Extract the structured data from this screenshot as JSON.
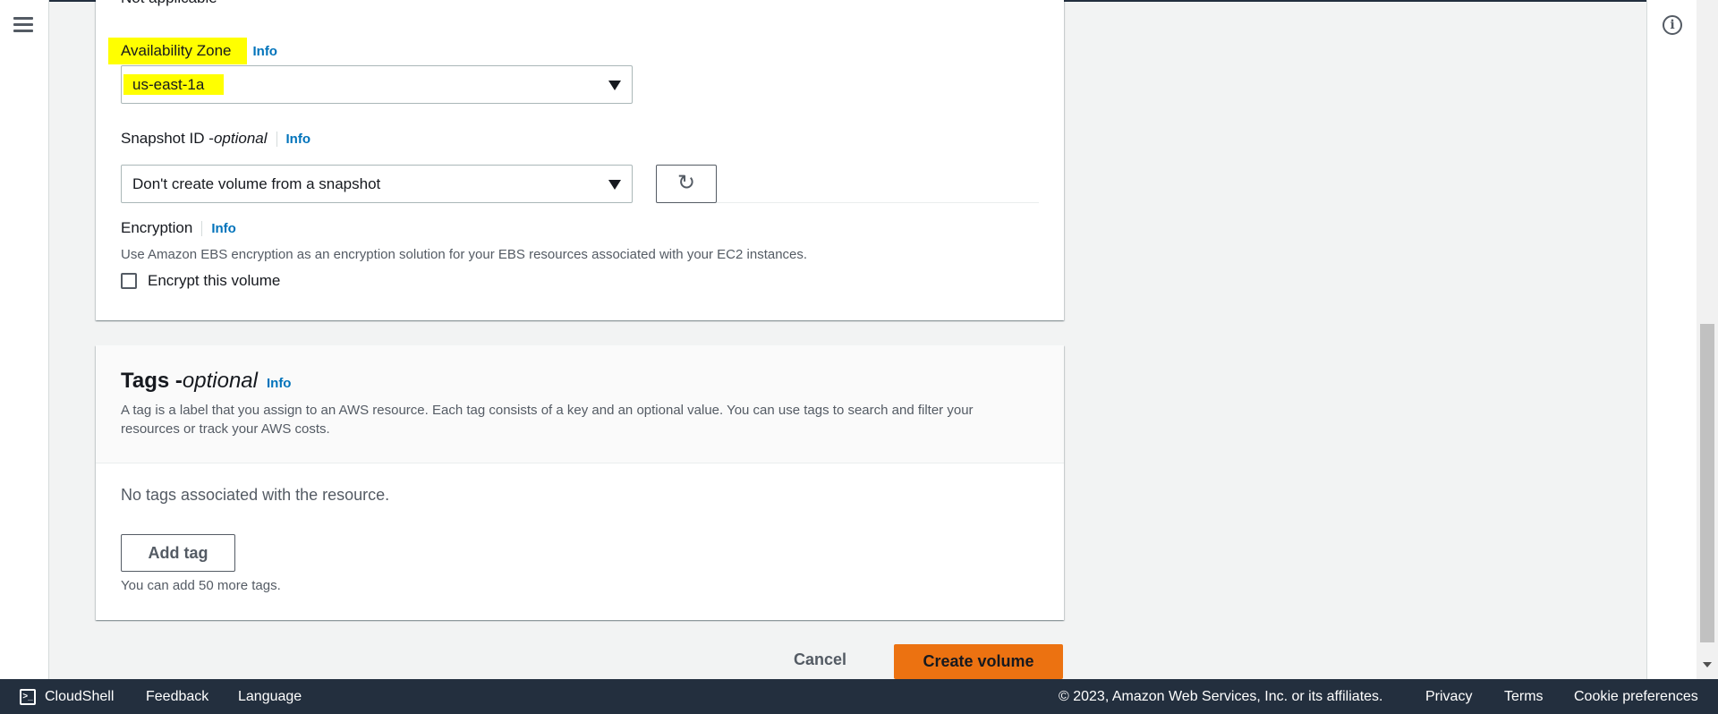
{
  "colors": {
    "accent_link": "#0073bb",
    "primary_button": "#ec7211",
    "footer_bg": "#232f3e",
    "highlight": "#ffff00"
  },
  "top_cut_text": "Not applicable",
  "availability_zone": {
    "label": "Availability Zone",
    "info": "Info",
    "value": "us-east-1a"
  },
  "snapshot": {
    "label": "Snapshot ID - ",
    "label_optional": "optional",
    "info": "Info",
    "value": "Don't create volume from a snapshot",
    "refresh_icon": "refresh-icon"
  },
  "encryption": {
    "label": "Encryption",
    "info": "Info",
    "description": "Use Amazon EBS encryption as an encryption solution for your EBS resources associated with your EC2 instances.",
    "checkbox_label": "Encrypt this volume",
    "checked": false
  },
  "tags": {
    "title": "Tags - ",
    "title_optional": "optional",
    "info": "Info",
    "description": "A tag is a label that you assign to an AWS resource. Each tag consists of a key and an optional value. You can use tags to search and filter your resources or track your AWS costs.",
    "empty_text": "No tags associated with the resource.",
    "add_button": "Add tag",
    "limit_text": "You can add 50 more tags."
  },
  "actions": {
    "cancel": "Cancel",
    "create": "Create volume"
  },
  "footer": {
    "cloudshell": "CloudShell",
    "feedback": "Feedback",
    "language": "Language",
    "copyright": "© 2023, Amazon Web Services, Inc. or its affiliates.",
    "privacy": "Privacy",
    "terms": "Terms",
    "cookie": "Cookie preferences"
  }
}
